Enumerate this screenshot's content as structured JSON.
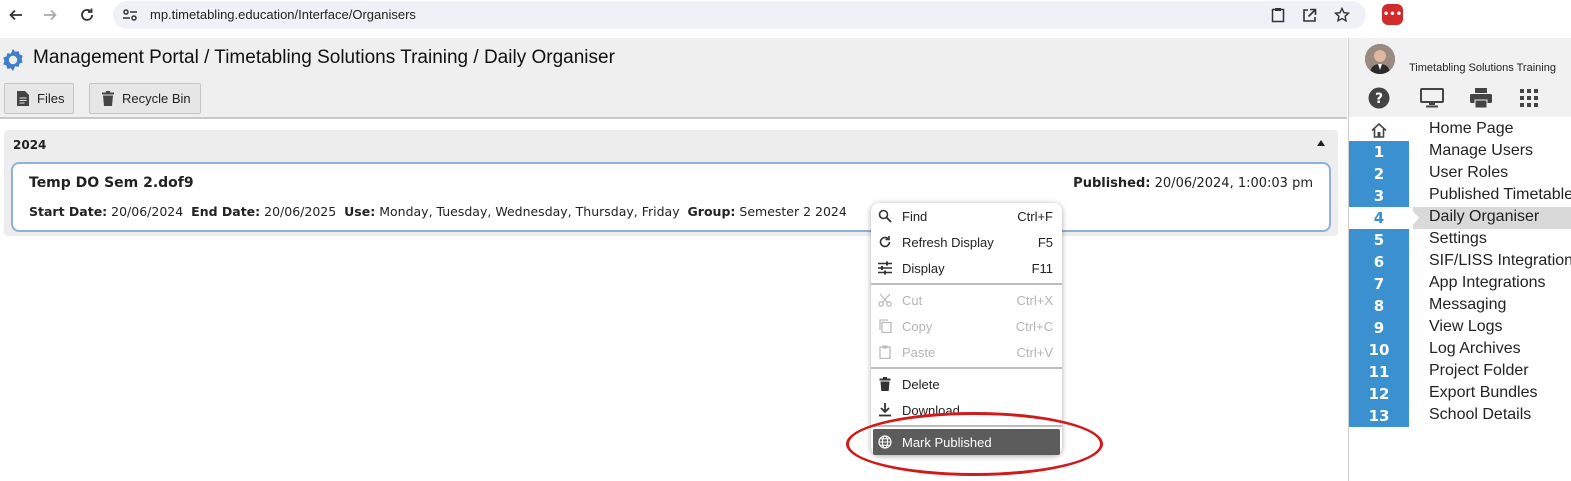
{
  "browser": {
    "url": "mp.timetabling.education/Interface/Organisers"
  },
  "header": {
    "breadcrumb": "Management Portal / Timetabling Solutions Training / Daily Organiser",
    "buttons": {
      "files": "Files",
      "recycle_bin": "Recycle Bin"
    }
  },
  "group": {
    "year": "2024",
    "file": {
      "name": "Temp DO Sem 2.dof9",
      "published_label": "Published:",
      "published_value": "20/06/2024, 1:00:03 pm",
      "start_label": "Start Date:",
      "start_value": "20/06/2024",
      "end_label": "End Date:",
      "end_value": "20/06/2025",
      "use_label": "Use:",
      "use_value": "Monday, Tuesday, Wednesday, Thursday, Friday",
      "group_label": "Group:",
      "group_value": "Semester 2 2024"
    }
  },
  "context_menu": {
    "items": [
      {
        "label": "Find",
        "shortcut": "Ctrl+F",
        "icon": "search-icon"
      },
      {
        "label": "Refresh Display",
        "shortcut": "F5",
        "icon": "refresh-icon"
      },
      {
        "label": "Display",
        "shortcut": "F11",
        "icon": "tune-icon"
      },
      {
        "label": "Cut",
        "shortcut": "Ctrl+X",
        "icon": "scissors-icon",
        "disabled": true
      },
      {
        "label": "Copy",
        "shortcut": "Ctrl+C",
        "icon": "copy-icon",
        "disabled": true
      },
      {
        "label": "Paste",
        "shortcut": "Ctrl+V",
        "icon": "clipboard-icon",
        "disabled": true
      },
      {
        "label": "Delete",
        "shortcut": "",
        "icon": "trash-icon"
      },
      {
        "label": "Download",
        "shortcut": "",
        "icon": "download-icon"
      },
      {
        "label": "Mark Published",
        "shortcut": "",
        "icon": "globe-icon",
        "highlighted": true
      }
    ]
  },
  "sidebar": {
    "user_name": "Timetabling Solutions Training",
    "nav": [
      {
        "num": "",
        "label": "Home Page"
      },
      {
        "num": "1",
        "label": "Manage Users"
      },
      {
        "num": "2",
        "label": "User Roles"
      },
      {
        "num": "3",
        "label": "Published Timetables"
      },
      {
        "num": "4",
        "label": "Daily Organiser",
        "active": true
      },
      {
        "num": "5",
        "label": "Settings"
      },
      {
        "num": "6",
        "label": "SIF/LISS Integration"
      },
      {
        "num": "7",
        "label": "App Integrations"
      },
      {
        "num": "8",
        "label": "Messaging"
      },
      {
        "num": "9",
        "label": "View Logs"
      },
      {
        "num": "10",
        "label": "Log Archives"
      },
      {
        "num": "11",
        "label": "Project Folder"
      },
      {
        "num": "12",
        "label": "Export Bundles"
      },
      {
        "num": "13",
        "label": "School Details"
      }
    ]
  },
  "colors": {
    "accent": "#3b91cf",
    "highlight": "#5c5c5c",
    "annotation": "#d21a1a"
  }
}
